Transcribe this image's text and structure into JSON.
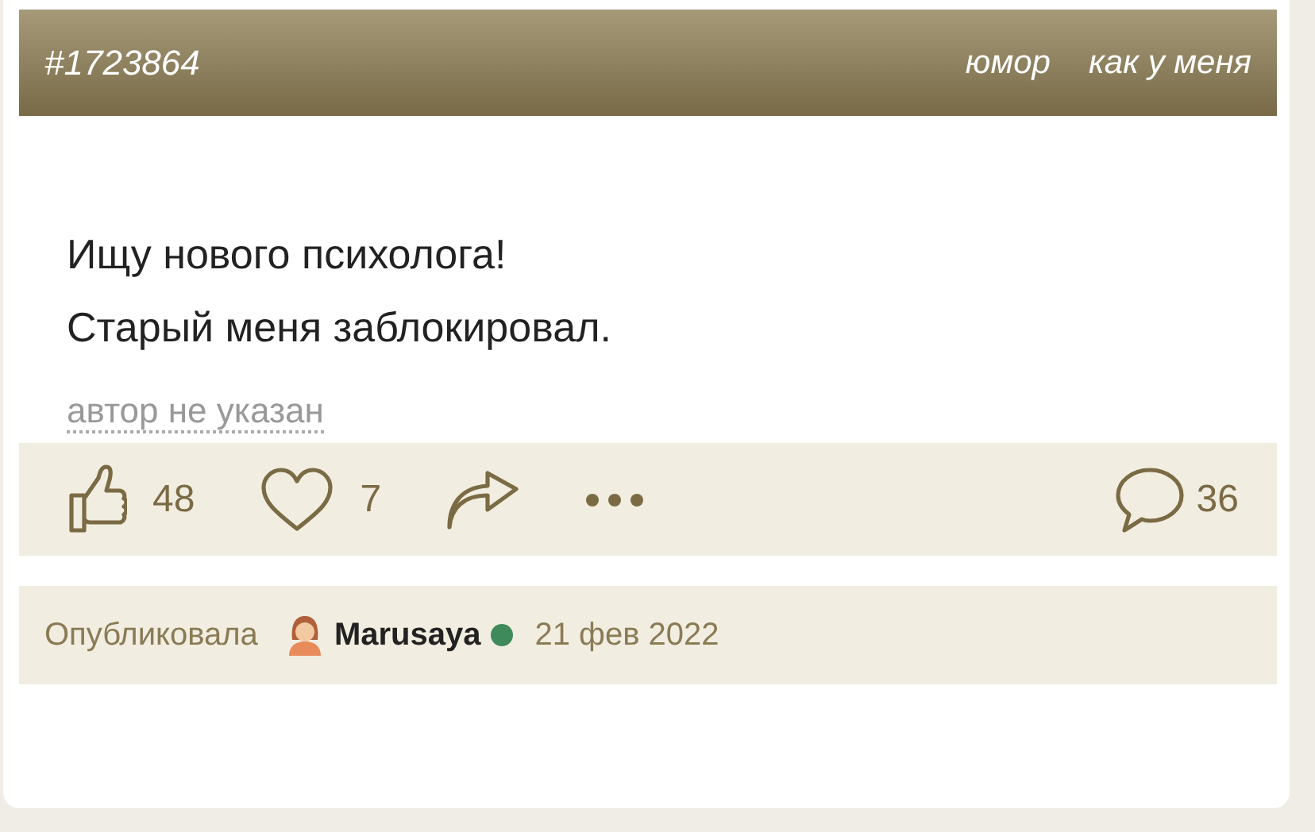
{
  "post": {
    "id": "#1723864",
    "tags": [
      "юмор",
      "как у меня"
    ],
    "text_lines": [
      "Ищу нового психолога!",
      "Старый меня заблокировал."
    ],
    "author_link": "автор не указан"
  },
  "actions": {
    "likes": "48",
    "hearts": "7",
    "comments": "36"
  },
  "footer": {
    "label": "Опубликовала",
    "user": "Marusaya",
    "online": true,
    "date": "21 фев 2022"
  }
}
